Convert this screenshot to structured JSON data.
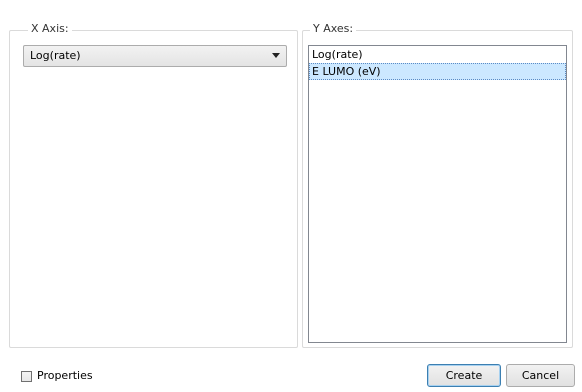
{
  "x_axis": {
    "label": "X Axis:",
    "selected": "Log(rate)"
  },
  "y_axes": {
    "label": "Y Axes:",
    "items": [
      {
        "label": "Log(rate)",
        "selected": false
      },
      {
        "label": "E LUMO (eV)",
        "selected": true
      }
    ]
  },
  "properties_checkbox": {
    "label": "Properties",
    "checked": false
  },
  "buttons": {
    "create": "Create",
    "cancel": "Cancel"
  }
}
